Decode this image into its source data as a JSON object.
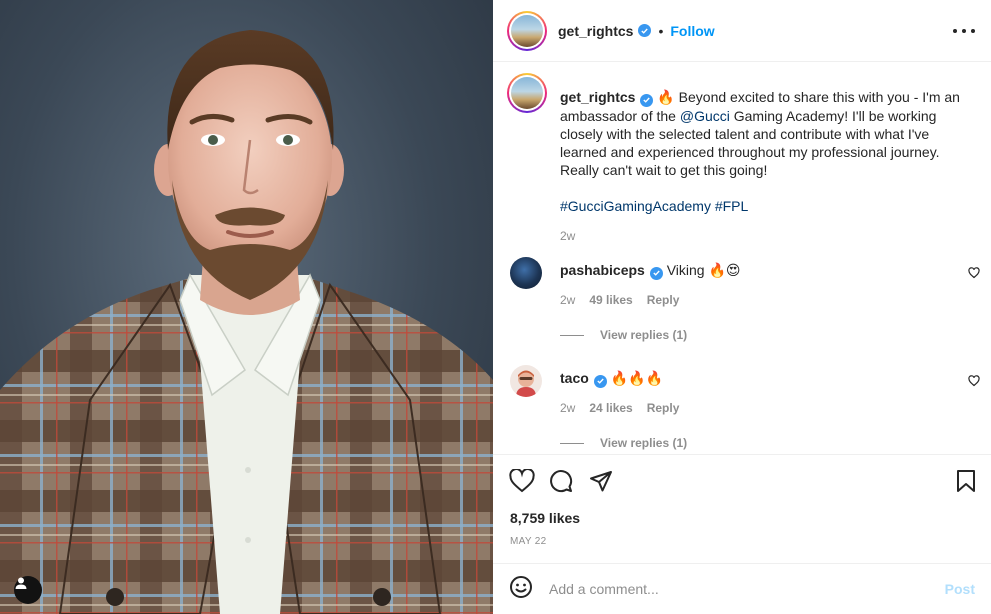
{
  "post": {
    "username": "get_rightcs",
    "follow_label": "Follow",
    "separator": "•",
    "caption": {
      "emoji": "🔥",
      "text_before_mention": " Beyond excited to share this with you - I'm an ambassador of the ",
      "mention": "@Gucci",
      "text_after_mention": " Gaming Academy! I'll be working closely with the selected talent and contribute with what I've learned and experienced throughout my professional journey. Really can't wait to get this going!",
      "hashtags": [
        "#GucciGamingAcademy",
        "#FPL"
      ],
      "time": "2w"
    },
    "comments": [
      {
        "username": "pashabiceps",
        "text": "Viking 🔥😍",
        "time": "2w",
        "likes": "49 likes",
        "reply_label": "Reply",
        "view_replies": "View replies (1)"
      },
      {
        "username": "taco",
        "text": "🔥🔥🔥",
        "time": "2w",
        "likes": "24 likes",
        "reply_label": "Reply",
        "view_replies": "View replies (1)"
      }
    ],
    "like_count": "8,759 likes",
    "date": "MAY 22",
    "add_comment_placeholder": "Add a comment...",
    "post_label": "Post"
  },
  "icons": {
    "like": "heart-icon",
    "comment": "comment-icon",
    "share": "send-icon",
    "save": "bookmark-icon",
    "emoji": "emoji-icon",
    "more": "more-options-icon",
    "tag": "user-tag-icon"
  },
  "colors": {
    "accent": "#0095f6",
    "link": "#00376b",
    "muted": "#8e8e8e",
    "verified": "#3897f0"
  }
}
